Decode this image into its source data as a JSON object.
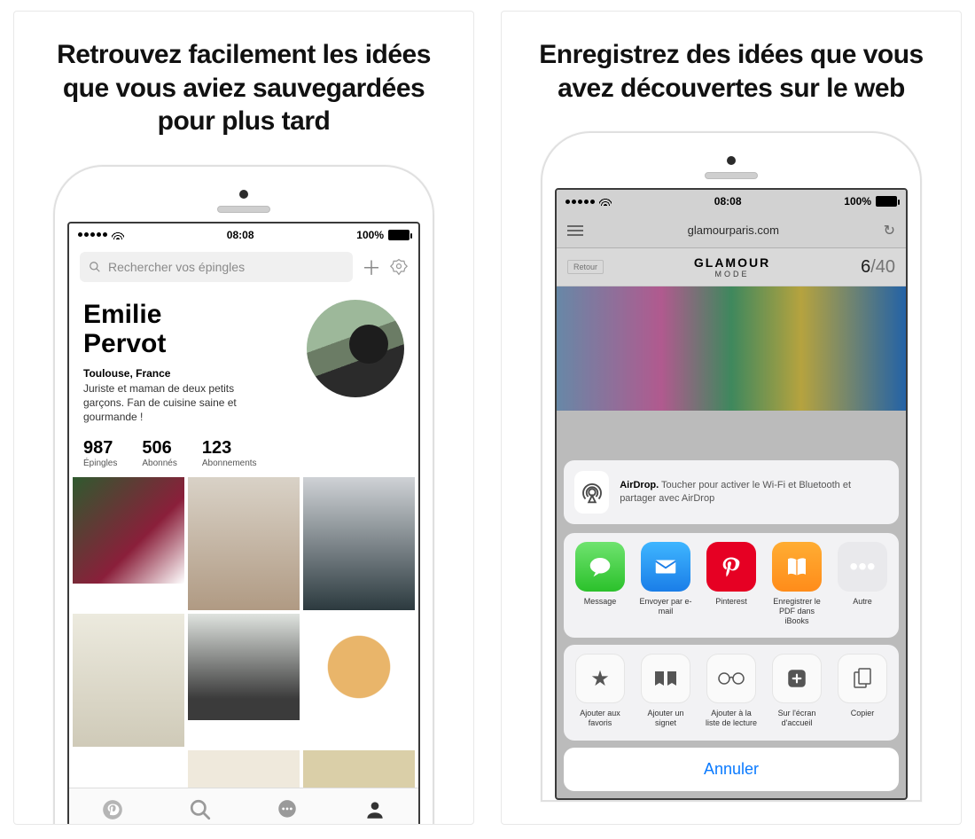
{
  "left": {
    "headline": "Retrouvez facilement les idées que vous aviez sauvegardées pour plus tard",
    "status": {
      "time": "08:08",
      "battery": "100%"
    },
    "search_placeholder": "Rechercher vos épingles",
    "profile": {
      "name_line1": "Emilie",
      "name_line2": "Pervot",
      "location": "Toulouse, France",
      "bio": "Juriste et maman de deux petits garçons. Fan de cuisine saine et gourmande !"
    },
    "stats": [
      {
        "n": "987",
        "l": "Épingles"
      },
      {
        "n": "506",
        "l": "Abonnés"
      },
      {
        "n": "123",
        "l": "Abonnements"
      }
    ]
  },
  "right": {
    "headline": "Enregistrez des idées que vous avez découvertes sur le web",
    "status": {
      "time": "08:08",
      "battery": "100%"
    },
    "url": "glamourparis.com",
    "back_label": "Retour",
    "site_logo_line1": "GLAMOUR",
    "site_logo_line2": "MODE",
    "page_current": "6",
    "page_total": "/40",
    "airdrop_bold": "AirDrop.",
    "airdrop_text": " Toucher pour activer le Wi-Fi et Bluetooth et partager avec AirDrop",
    "share_apps": [
      {
        "label": "Message"
      },
      {
        "label": "Envoyer par e-mail"
      },
      {
        "label": "Pinterest"
      },
      {
        "label": "Enregistrer le PDF dans iBooks"
      },
      {
        "label": "Autre"
      }
    ],
    "actions": [
      {
        "label": "Ajouter aux favoris"
      },
      {
        "label": "Ajouter un signet"
      },
      {
        "label": "Ajouter à la liste de lecture"
      },
      {
        "label": "Sur l'écran d'accueil"
      },
      {
        "label": "Copier"
      }
    ],
    "cancel": "Annuler"
  }
}
